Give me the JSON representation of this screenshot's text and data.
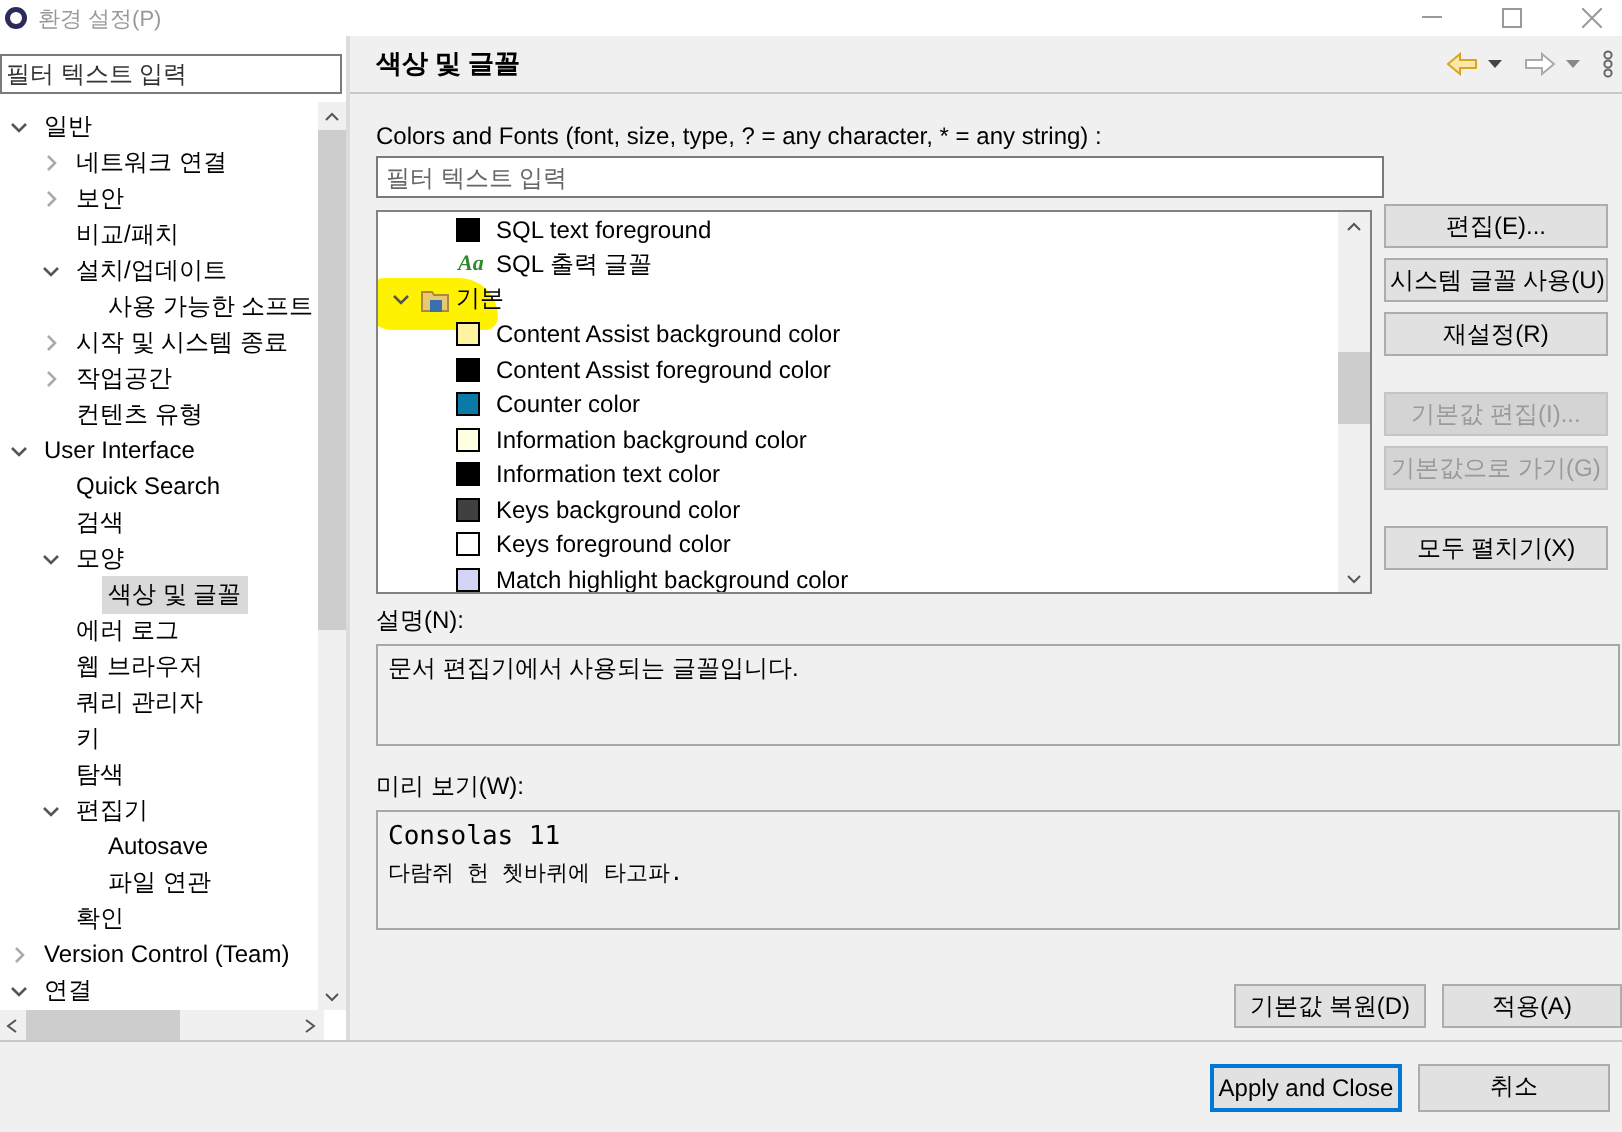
{
  "window": {
    "title": "환경 설정(P)"
  },
  "sidebar": {
    "filter": {
      "placeholder": "필터 텍스트 입력"
    },
    "tree": [
      {
        "label": "일반",
        "expanded": true,
        "selected": false,
        "children": [
          {
            "label": "네트워크 연결",
            "expanded": false,
            "selected": false
          },
          {
            "label": "보안",
            "expanded": false,
            "selected": false
          },
          {
            "label": "비교/패치",
            "selected": false
          },
          {
            "label": "설치/업데이트",
            "expanded": true,
            "selected": false,
            "children": [
              {
                "label": "사용 가능한 소프트",
                "selected": false
              }
            ]
          },
          {
            "label": "시작 및 시스템 종료",
            "expanded": false,
            "selected": false
          },
          {
            "label": "작업공간",
            "expanded": false,
            "selected": false
          },
          {
            "label": "컨텐츠 유형",
            "selected": false
          }
        ]
      },
      {
        "label": "User Interface",
        "expanded": true,
        "selected": false,
        "children": [
          {
            "label": "Quick Search",
            "selected": false
          },
          {
            "label": "검색",
            "selected": false
          },
          {
            "label": "모양",
            "expanded": true,
            "selected": false,
            "children": [
              {
                "label": "색상 및 글꼴",
                "selected": true
              }
            ]
          },
          {
            "label": "에러 로그",
            "selected": false
          },
          {
            "label": "웹 브라우저",
            "selected": false
          },
          {
            "label": "쿼리 관리자",
            "selected": false
          },
          {
            "label": "키",
            "selected": false
          },
          {
            "label": "탐색",
            "selected": false
          },
          {
            "label": "편집기",
            "expanded": true,
            "selected": false,
            "children": [
              {
                "label": "Autosave",
                "selected": false
              },
              {
                "label": "파일 연관",
                "selected": false
              }
            ]
          },
          {
            "label": "확인",
            "selected": false
          }
        ]
      },
      {
        "label": "Version Control (Team)",
        "expanded": false,
        "selected": false
      },
      {
        "label": "연결",
        "expanded": true,
        "selected": false
      }
    ]
  },
  "page": {
    "title": "색상 및 글꼴",
    "filter_label": "Colors and Fonts (font, size, type, ? = any character, * = any string) :",
    "filter": {
      "placeholder": "필터 텍스트 입력"
    },
    "tree": [
      {
        "kind": "color",
        "label": "SQL text foreground",
        "color": "#000000"
      },
      {
        "kind": "font",
        "icon": "Aa",
        "label": "SQL 출력 글꼴"
      },
      {
        "kind": "category",
        "label": "기본",
        "expanded": true,
        "highlighted": true,
        "children": [
          {
            "kind": "color",
            "label": "Content Assist background color",
            "color": "#fdf3a0"
          },
          {
            "kind": "color",
            "label": "Content Assist foreground color",
            "color": "#000000"
          },
          {
            "kind": "color",
            "label": "Counter color",
            "color": "#0a7aa6"
          },
          {
            "kind": "color",
            "label": "Information background color",
            "color": "#ffffe1"
          },
          {
            "kind": "color",
            "label": "Information text color",
            "color": "#000000"
          },
          {
            "kind": "color",
            "label": "Keys background color",
            "color": "#404040"
          },
          {
            "kind": "color",
            "label": "Keys foreground color",
            "color": "#ffffff"
          },
          {
            "kind": "color",
            "label": "Match highlight background color",
            "color": "#d4d4f6"
          }
        ]
      }
    ],
    "side_buttons": [
      {
        "label": "편집(E)...",
        "disabled": false
      },
      {
        "label": "시스템 글꼴 사용(U)",
        "disabled": false
      },
      {
        "label": "재설정(R)",
        "disabled": false
      },
      {
        "label": "기본값 편집(I)...",
        "disabled": true
      },
      {
        "label": "기본값으로 가기(G)",
        "disabled": true
      },
      {
        "label": "모두 펼치기(X)",
        "disabled": false
      }
    ],
    "description_label": "설명(N):",
    "description": "문서 편집기에서 사용되는 글꼴입니다.",
    "preview_label": "미리 보기(W):",
    "preview": {
      "font_name": "Consolas 11",
      "sample": "다람쥐 헌 쳇바퀴에 타고파."
    },
    "page_buttons": [
      "기본값 복원(D)",
      "적용(A)"
    ]
  },
  "footer_buttons": [
    {
      "label": "Apply and Close",
      "default": true
    },
    {
      "label": "취소",
      "default": false
    }
  ]
}
